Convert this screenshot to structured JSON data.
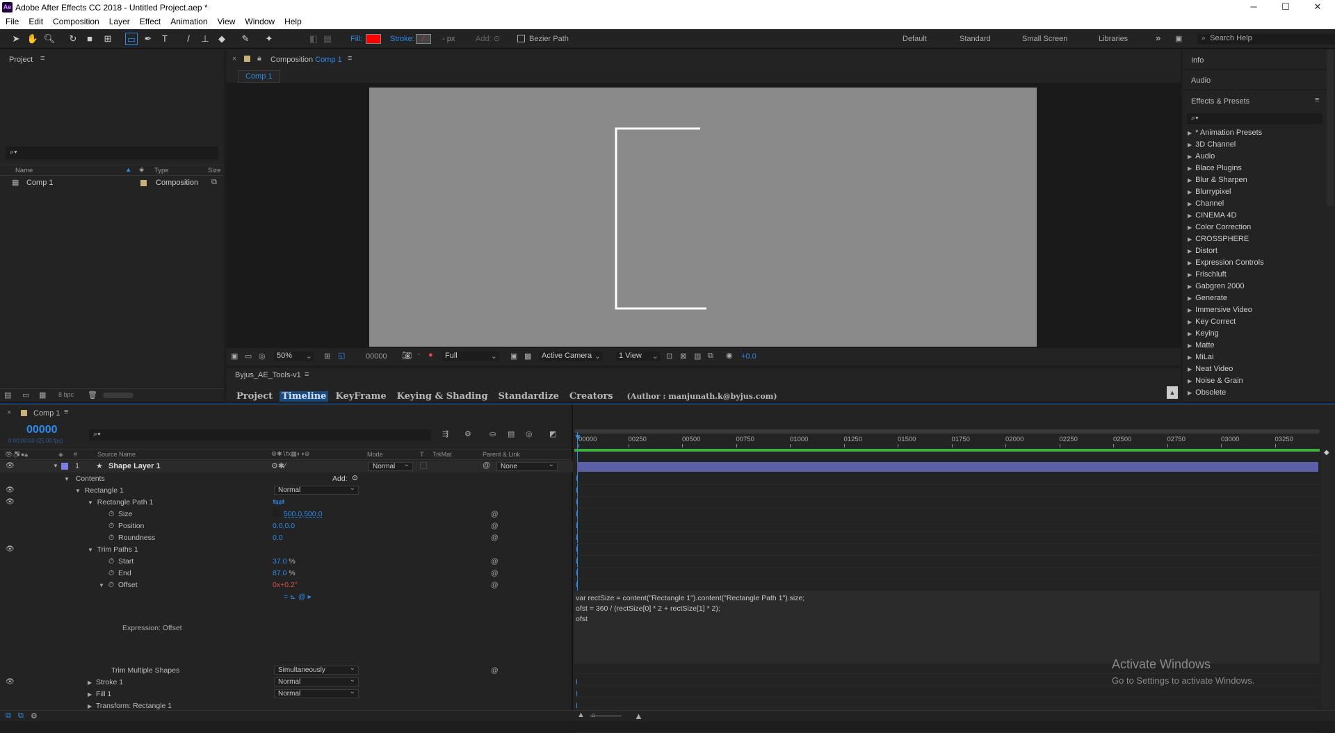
{
  "app": {
    "title": "Adobe After Effects CC 2018 - Untitled Project.aep *",
    "logo": "Ae"
  },
  "window_controls": {
    "minimize": "─",
    "maximize": "☐",
    "close": "✕"
  },
  "menu": [
    "File",
    "Edit",
    "Composition",
    "Layer",
    "Effect",
    "Animation",
    "View",
    "Window",
    "Help"
  ],
  "toolbar": {
    "fill_label": "Fill:",
    "stroke_label": "Stroke:",
    "stroke_px": "- px",
    "add_label": "Add:",
    "bezier_label": "Bezier Path",
    "fill_color": "#ff0000",
    "workspaces": [
      "Default",
      "Standard",
      "Small Screen",
      "Libraries"
    ],
    "more": "»",
    "search_help": "Search Help"
  },
  "project": {
    "title": "Project",
    "search_placeholder": "⌕▾",
    "cols": {
      "name": "Name",
      "type": "Type",
      "size": "Size"
    },
    "item": {
      "name": "Comp 1",
      "type": "Composition"
    },
    "bpc": "8 bpc"
  },
  "composition": {
    "title_prefix": "Composition",
    "comp_name": "Comp 1",
    "tab": "Comp 1",
    "zoom": "50%",
    "timecode": "00000",
    "resolution": "Full",
    "camera": "Active Camera",
    "view": "1 View",
    "exposure": "+0.0"
  },
  "tools_panel": {
    "title": "Byjus_AE_Tools-v1",
    "tabs": [
      "Project",
      "Timeline",
      "KeyFrame",
      "Keying & Shading",
      "Standardize",
      "Creators"
    ],
    "author": "(Author : manjunath.k@byjus.com)",
    "active_tab": "Timeline"
  },
  "right": {
    "info": "Info",
    "audio": "Audio",
    "effects": "Effects & Presets",
    "search_placeholder": "⌕▾",
    "effects_list": [
      "* Animation Presets",
      "3D Channel",
      "Audio",
      "Blace Plugins",
      "Blur & Sharpen",
      "Blurrypixel",
      "Channel",
      "CINEMA 4D",
      "Color Correction",
      "CROSSPHERE",
      "Distort",
      "Expression Controls",
      "Frischluft",
      "Gabgren 2000",
      "Generate",
      "Immersive Video",
      "Key Correct",
      "Keying",
      "Matte",
      "MiLai",
      "Neat Video",
      "Noise & Grain",
      "Obsolete"
    ]
  },
  "timeline": {
    "tab": "Comp 1",
    "timecode": "00000",
    "timecode_sub": "0:00:00:00 (25.00 fps)",
    "search_placeholder": "⌕▾",
    "headers": {
      "num": "#",
      "source": "Source Name",
      "mode": "Mode",
      "t": "T",
      "trkmat": "TrkMat",
      "parent": "Parent & Link"
    },
    "layer": {
      "num": "1",
      "name": "Shape Layer 1",
      "mode": "Normal",
      "parent": "None"
    },
    "contents": "Contents",
    "add": "Add:",
    "rectangle": "Rectangle 1",
    "rect_mode": "Normal",
    "rect_path": "Rectangle Path 1",
    "size_label": "Size",
    "size_value": "500.0,500.0",
    "position_label": "Position",
    "position_value": "0.0,0.0",
    "roundness_label": "Roundness",
    "roundness_value": "0.0",
    "trim": "Trim Paths 1",
    "start_label": "Start",
    "start_value": "37.0",
    "end_label": "End",
    "end_value": "87.0",
    "pct": "%",
    "offset_label": "Offset",
    "offset_value": "0x+0.2°",
    "expression_label": "Expression: Offset",
    "trim_multiple": "Trim Multiple Shapes",
    "trim_multiple_value": "Simultaneously",
    "stroke": "Stroke 1",
    "stroke_mode": "Normal",
    "fill": "Fill 1",
    "fill_mode": "Normal",
    "transform": "Transform: Rectangle 1",
    "expression_lines": [
      "var rectSize = content(\"Rectangle 1\").content(\"Rectangle Path 1\").size;",
      "ofst = 360 / (rectSize[0] * 2 + rectSize[1] * 2);",
      "ofst"
    ],
    "ruler": [
      "00000",
      "00250",
      "00500",
      "00750",
      "01000",
      "01250",
      "01500",
      "01750",
      "02000",
      "02250",
      "02500",
      "02750",
      "03000",
      "03250"
    ],
    "layer_bar_color": "#5a5fa8",
    "work_area_color": "#3fae3f"
  },
  "watermark": {
    "line1": "Activate Windows",
    "line2": "Go to Settings to activate Windows."
  }
}
